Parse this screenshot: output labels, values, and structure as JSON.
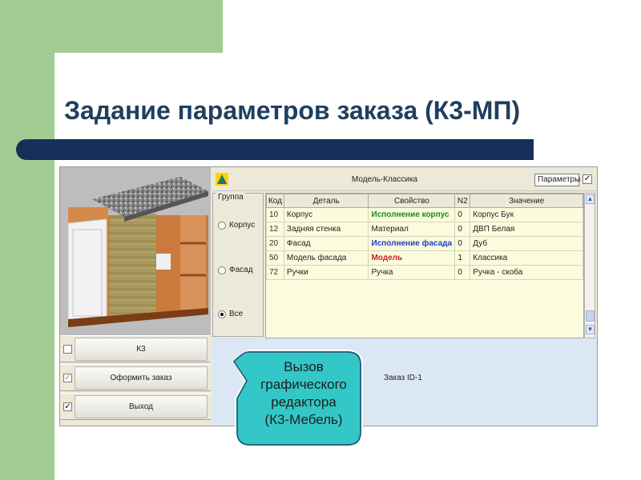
{
  "slide": {
    "title": "Задание параметров заказа (К3-МП)",
    "colors": {
      "green": "#a3cc92",
      "navy_bar": "#16305a",
      "title": "#1f3f5f",
      "callout": "#34c7c7"
    }
  },
  "app": {
    "toolbar": {
      "icon": "app-logo-icon",
      "model_title": "Модель-Классика",
      "params_label": "Параметры",
      "params_checked_mark": "✓"
    },
    "group": {
      "title": "Группа",
      "options": [
        {
          "label": "Корпус",
          "selected": false
        },
        {
          "label": "Фасад",
          "selected": false
        },
        {
          "label": "Все",
          "selected": true
        }
      ]
    },
    "table": {
      "headers": [
        "Код",
        "Деталь",
        "Свойство",
        "N2",
        "Значение"
      ],
      "rows": [
        {
          "code": "10",
          "part": "Корпус",
          "property": "Исполнение корпус",
          "n2": "0",
          "value": "Корпус Бук",
          "prop_color": "#1a8a1a",
          "prop_bold": true
        },
        {
          "code": "12",
          "part": "Задняя стенка",
          "property": "Материал",
          "n2": "0",
          "value": "ДВП Белая",
          "prop_color": "#222222",
          "prop_bold": false
        },
        {
          "code": "20",
          "part": "Фасад",
          "property": "Исполнение фасада",
          "n2": "0",
          "value": "Дуб",
          "prop_color": "#1f3fbf",
          "prop_bold": true
        },
        {
          "code": "50",
          "part": "Модель фасада",
          "property": "Модель",
          "n2": "1",
          "value": "Классика",
          "prop_color": "#d02020",
          "prop_bold": true
        },
        {
          "code": "72",
          "part": "Ручки",
          "property": "Ручка",
          "n2": "0",
          "value": "Ручка - скоба",
          "prop_color": "#222222",
          "prop_bold": false
        }
      ]
    },
    "side_buttons": [
      {
        "label": "К3",
        "check": ""
      },
      {
        "label": "Оформить заказ",
        "check": "✓"
      },
      {
        "label": "Выход",
        "check": "✓"
      }
    ],
    "order_label": "Заказ ID-1"
  },
  "callout": {
    "lines": [
      "Вызов",
      "графического",
      "редактора",
      "(К3-Мебель)"
    ]
  }
}
